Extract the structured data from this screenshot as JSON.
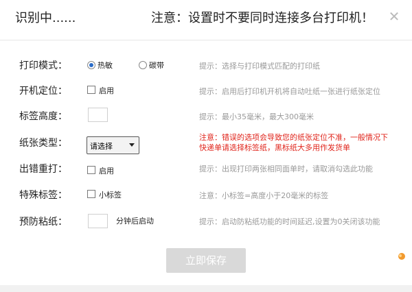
{
  "window": {
    "title": "识别中......",
    "notice": "注意：设置时不要同时连接多台打印机！",
    "close_glyph": "✕"
  },
  "rows": {
    "print_mode": {
      "label": "打印模式：",
      "options": [
        "热敏",
        "碳带"
      ],
      "selected": "热敏",
      "hint": "提示：选择与打印模式匹配的打印纸"
    },
    "power_on_position": {
      "label": "开机定位：",
      "checkbox_label": "启用",
      "checked": false,
      "hint": "提示：启用后打印机开机将自动吐纸一张进行纸张定位"
    },
    "label_height": {
      "label": "标签高度：",
      "value": "",
      "hint": "提示：最小35毫米，最大300毫米"
    },
    "paper_type": {
      "label": "纸张类型：",
      "selected": "请选择",
      "hint_line1": "注意：错误的选项会导致您的纸张定位不准，一般情况下",
      "hint_line2": "快递单请选择标签纸，黑标纸大多用作发货单"
    },
    "error_reprint": {
      "label": "出错重打：",
      "checkbox_label": "启用",
      "checked": false,
      "hint": "提示：出现打印两张相同面单时，请取消勾选此功能"
    },
    "special_label": {
      "label": "特殊标签：",
      "checkbox_label": "小标签",
      "checked": false,
      "hint": "注意：小标签=高度小于20毫米的标签"
    },
    "anti_stick": {
      "label": "预防粘纸：",
      "value": "",
      "suffix": "分钟后启动",
      "hint": "提示：启动防粘纸功能的时间延迟,设置为0关闭该功能"
    }
  },
  "save_button": "立即保存",
  "colors": {
    "accent": "#2a6cc8",
    "warning": "#e0241b",
    "hint": "#999999",
    "save_bg": "#d9d9d9"
  }
}
